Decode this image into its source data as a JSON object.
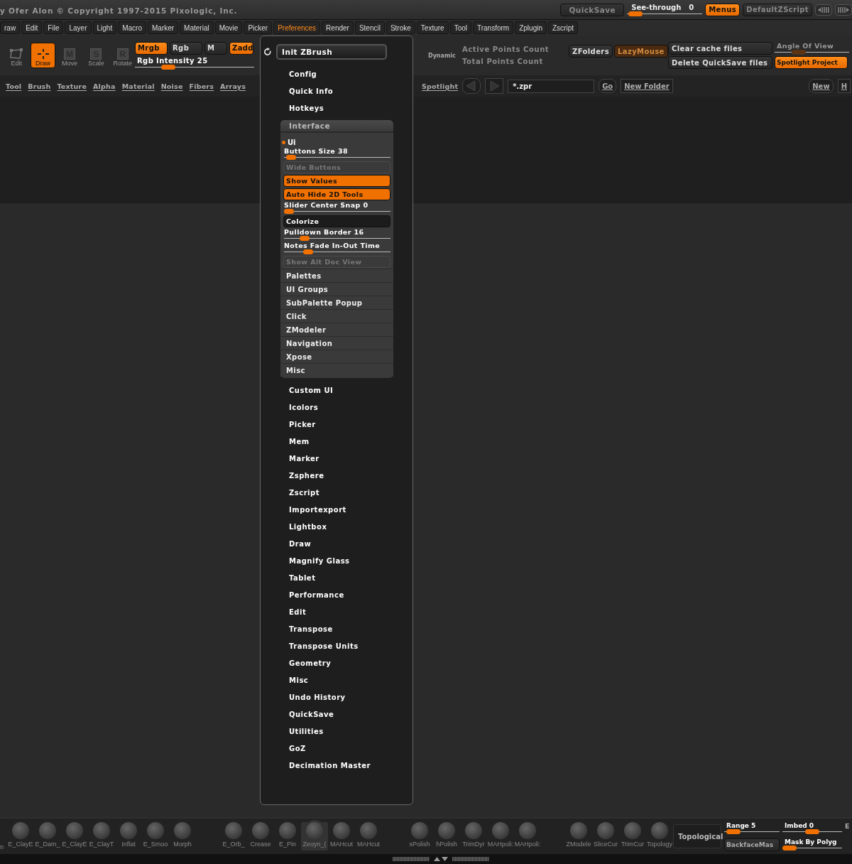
{
  "title_bar": {
    "copyright": "y Ofer Alon © Copyright 1997-2015 Pixologic, Inc.",
    "quicksave": "QuickSave",
    "see_through": {
      "label": "See-through",
      "value": "0",
      "level": 0.02
    },
    "buttons": [
      {
        "label": "Menus",
        "on": true
      },
      {
        "label": "DefaultZScript",
        "on": false
      }
    ]
  },
  "menu_bar": [
    {
      "label": "raw",
      "selected": false
    },
    {
      "label": "Edit",
      "selected": false
    },
    {
      "label": "File",
      "selected": false
    },
    {
      "label": "Layer",
      "selected": false
    },
    {
      "label": "Light",
      "selected": false
    },
    {
      "label": "Macro",
      "selected": false
    },
    {
      "label": "Marker",
      "selected": false
    },
    {
      "label": "Material",
      "selected": false
    },
    {
      "label": "Movie",
      "selected": false
    },
    {
      "label": "Picker",
      "selected": false
    },
    {
      "label": "Preferences",
      "selected": true
    },
    {
      "label": "Render",
      "selected": false
    },
    {
      "label": "Stencil",
      "selected": false
    },
    {
      "label": "Stroke",
      "selected": false
    },
    {
      "label": "Texture",
      "selected": false
    },
    {
      "label": "Tool",
      "selected": false
    },
    {
      "label": "Transform",
      "selected": false
    },
    {
      "label": "Zplugin",
      "selected": false
    },
    {
      "label": "Zscript",
      "selected": false
    }
  ],
  "tools": [
    {
      "kind": "edit",
      "label": "Edit",
      "selected": false
    },
    {
      "kind": "draw",
      "label": "Draw",
      "selected": true
    },
    {
      "kind": "key",
      "key": "M",
      "label": "Move",
      "selected": false
    },
    {
      "kind": "key",
      "key": "S",
      "label": "Scale",
      "selected": false
    },
    {
      "kind": "key",
      "key": "R",
      "label": "Rotate",
      "selected": false
    }
  ],
  "color_modes": [
    {
      "label": "Mrgb",
      "on": true
    },
    {
      "label": "Rgb",
      "on": false
    },
    {
      "label": "M",
      "on": false
    },
    {
      "label": "Zadd",
      "on": true
    }
  ],
  "rgb_intensity": {
    "label": "Rgb Intensity 25",
    "level": 0.25
  },
  "dynamic": "Dynamic",
  "points": [
    "Active Points Count",
    "Total Points Count"
  ],
  "file_buttons": [
    {
      "label": "ZFolders",
      "on": false,
      "disabled": false
    },
    {
      "label": "LazyMouse",
      "on": true,
      "disabled": true
    }
  ],
  "cache_buttons": [
    "Clear cache files",
    "Delete QuickSave files"
  ],
  "angle_of_view": {
    "label": "Angle Of View",
    "level": 0.28
  },
  "spotlight_projection": {
    "label": "Spotlight Project",
    "on": true
  },
  "shelf": {
    "links": [
      "Tool",
      "Brush",
      "Texture",
      "Alpha",
      "Material",
      "Noise",
      "Fibers",
      "Arrays"
    ],
    "links_right": [
      "Spotlight"
    ],
    "file_field": {
      "value": "*.zpr"
    },
    "go": "Go",
    "new_folder": "New Folder",
    "new": "New",
    "h": "H"
  },
  "preferences_menu": {
    "init": "Init ZBrush",
    "items_top": [
      "Config",
      "Quick Info",
      "Hotkeys"
    ],
    "interface": {
      "title": "Interface",
      "expanded": true,
      "ui": {
        "label": "Ui",
        "expanded": true,
        "controls": [
          {
            "kind": "slider",
            "label": "Buttons Size 38",
            "level": 0.02
          },
          {
            "kind": "toggle",
            "label": "Wide Buttons",
            "on": false,
            "disabled": true
          },
          {
            "kind": "toggle",
            "label": "Show Values",
            "on": true,
            "disabled": false
          },
          {
            "kind": "toggle",
            "label": "Auto Hide 2D Tools",
            "on": true,
            "disabled": false
          },
          {
            "kind": "slider",
            "label": "Slider Center Snap 0",
            "level": 0.0
          },
          {
            "kind": "toggle",
            "label": "Colorize",
            "on": false,
            "disabled": false
          },
          {
            "kind": "slider",
            "label": "Pulldown Border 16",
            "level": 0.16
          },
          {
            "kind": "slider",
            "label": "Notes Fade In-Out Time",
            "level": 0.2
          },
          {
            "kind": "toggle",
            "label": "Show Alt Doc View",
            "on": false,
            "disabled": true
          }
        ]
      },
      "subgroups": [
        "Palettes",
        "UI Groups",
        "SubPalette Popup",
        "Click",
        "ZModeler",
        "Navigation",
        "Xpose",
        "Misc"
      ]
    },
    "items_bottom": [
      "Custom UI",
      "Icolors",
      "Picker",
      "Mem",
      "Marker",
      "Zsphere",
      "Zscript",
      "Importexport",
      "Lightbox",
      "Draw",
      "Magnify Glass",
      "Tablet",
      "Performance",
      "Edit",
      "Transpose",
      "Transpose Units",
      "Geometry",
      "Misc",
      "Undo History",
      "QuickSave",
      "Utilities",
      "GoZ",
      "Decimation Master"
    ]
  },
  "bottom_shelf": {
    "brush_groups": [
      [
        {
          "label": "n",
          "selected": false
        },
        {
          "label": "E_ClayE",
          "selected": false
        },
        {
          "label": "E_Dam_",
          "selected": false
        },
        {
          "label": "E_ClayE",
          "selected": false
        },
        {
          "label": "E_ClayT",
          "selected": false
        },
        {
          "label": "Inflat",
          "selected": false
        },
        {
          "label": "E_Smoo",
          "selected": false
        },
        {
          "label": "Morph",
          "selected": false
        }
      ],
      [
        {
          "label": "E_Orb_",
          "selected": false
        },
        {
          "label": "Crease",
          "selected": false
        },
        {
          "label": "E_Pin",
          "selected": false
        },
        {
          "label": "Zeoyn_(",
          "selected": true
        },
        {
          "label": "MAHcut",
          "selected": false
        },
        {
          "label": "MAHcut",
          "selected": false
        }
      ],
      [
        {
          "label": "sPolish",
          "selected": false
        },
        {
          "label": "hPolish",
          "selected": false
        },
        {
          "label": "TrimDyr",
          "selected": false
        },
        {
          "label": "MAHpoli:",
          "selected": false
        },
        {
          "label": "MAHpoli:",
          "selected": false
        }
      ],
      [
        {
          "label": "ZModele",
          "selected": false
        },
        {
          "label": "SliceCur",
          "selected": false
        },
        {
          "label": "TrimCur",
          "selected": false
        },
        {
          "label": "Topology",
          "selected": false
        }
      ]
    ],
    "topological": "Topological",
    "range": {
      "label": "Range 5",
      "level": 0.05
    },
    "imbed": {
      "label": "Imbed 0",
      "level": 0.5
    },
    "cut_label": "E",
    "backface": "BackfaceMas",
    "mask_by_polygroups": {
      "label": "Mask By Polyg",
      "level": 0.0
    }
  }
}
